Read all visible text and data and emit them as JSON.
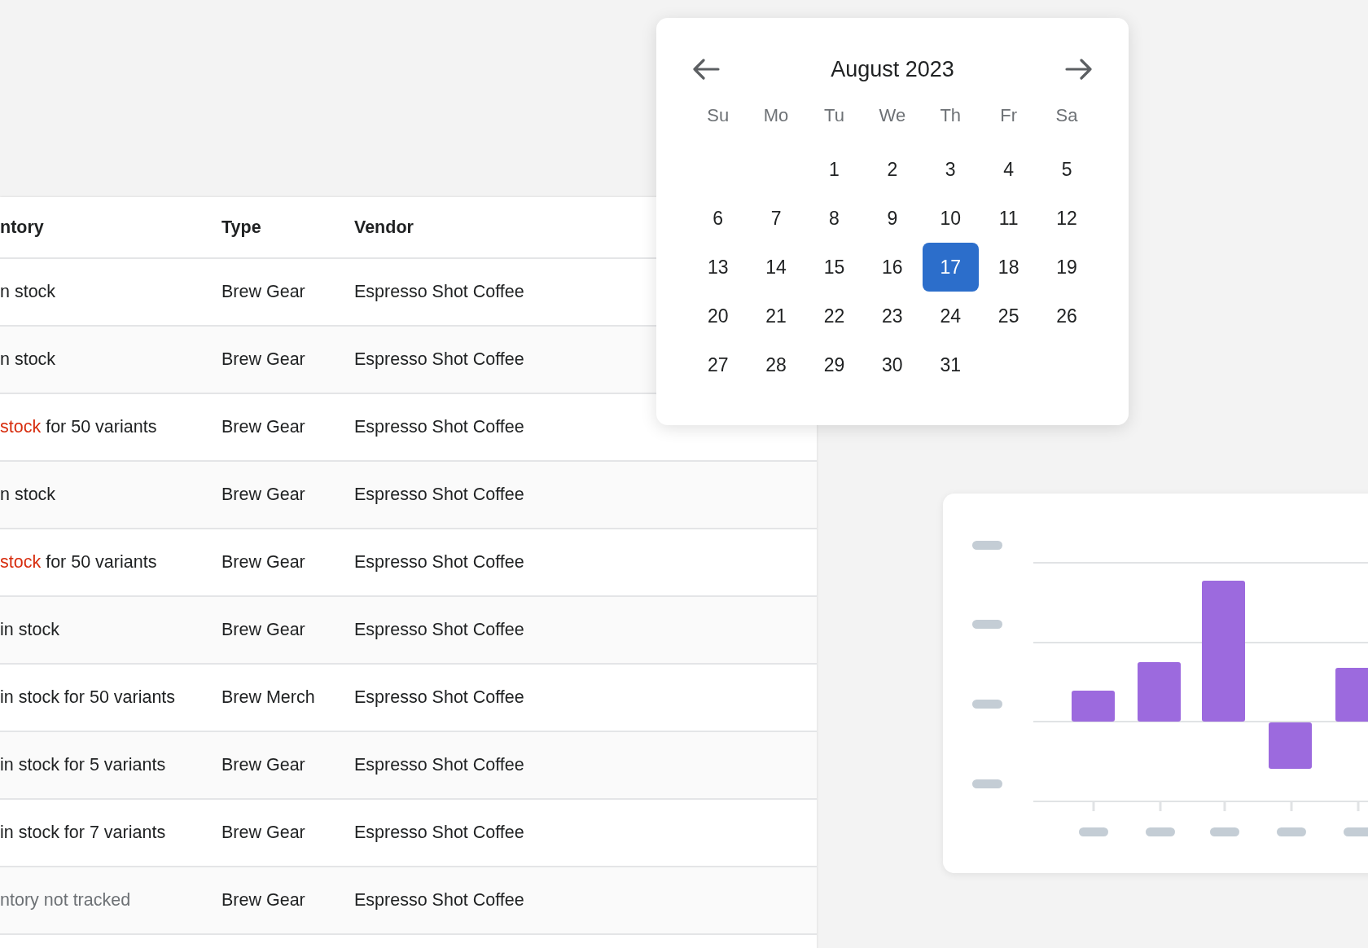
{
  "table": {
    "columns": [
      "ntory",
      "Type",
      "Vendor"
    ],
    "rows": [
      {
        "inventory": [
          {
            "text": "n stock",
            "kind": "default"
          }
        ],
        "type": "Brew Gear",
        "vendor": "Espresso Shot Coffee"
      },
      {
        "inventory": [
          {
            "text": "n stock",
            "kind": "default"
          }
        ],
        "type": "Brew Gear",
        "vendor": "Espresso Shot Coffee"
      },
      {
        "inventory": [
          {
            "text": "stock",
            "kind": "critical"
          },
          {
            "text": " for 50 variants",
            "kind": "default"
          }
        ],
        "type": "Brew Gear",
        "vendor": "Espresso Shot Coffee"
      },
      {
        "inventory": [
          {
            "text": "n stock",
            "kind": "default"
          }
        ],
        "type": "Brew Gear",
        "vendor": "Espresso Shot Coffee"
      },
      {
        "inventory": [
          {
            "text": "stock",
            "kind": "critical"
          },
          {
            "text": " for 50 variants",
            "kind": "default"
          }
        ],
        "type": "Brew Gear",
        "vendor": "Espresso Shot Coffee"
      },
      {
        "inventory": [
          {
            "text": " in stock",
            "kind": "default"
          }
        ],
        "type": "Brew Gear",
        "vendor": "Espresso Shot Coffee"
      },
      {
        "inventory": [
          {
            "text": " in stock for 50 variants",
            "kind": "default"
          }
        ],
        "type": "Brew Merch",
        "vendor": "Espresso Shot Coffee"
      },
      {
        "inventory": [
          {
            "text": " in stock for 5 variants",
            "kind": "default"
          }
        ],
        "type": "Brew Gear",
        "vendor": "Espresso Shot Coffee"
      },
      {
        "inventory": [
          {
            "text": " in stock for 7 variants",
            "kind": "default"
          }
        ],
        "type": "Brew Gear",
        "vendor": "Espresso Shot Coffee"
      },
      {
        "inventory": [
          {
            "text": "ntory not tracked",
            "kind": "subdued"
          }
        ],
        "type": "Brew Gear",
        "vendor": "Espresso Shot Coffee"
      }
    ]
  },
  "calendar": {
    "title": "August 2023",
    "weekdays": [
      "Su",
      "Mo",
      "Tu",
      "We",
      "Th",
      "Fr",
      "Sa"
    ],
    "weeks": [
      {
        "kind": "first",
        "days": [
          {
            "day": "1",
            "selected": false
          },
          {
            "day": "2",
            "selected": false
          },
          {
            "day": "3",
            "selected": false
          },
          {
            "day": "4",
            "selected": false
          },
          {
            "day": "5",
            "selected": false
          }
        ]
      },
      {
        "kind": "full",
        "days": [
          {
            "day": "6",
            "selected": false
          },
          {
            "day": "7",
            "selected": false
          },
          {
            "day": "8",
            "selected": false
          },
          {
            "day": "9",
            "selected": false
          },
          {
            "day": "10",
            "selected": false
          },
          {
            "day": "11",
            "selected": false
          },
          {
            "day": "12",
            "selected": false
          }
        ]
      },
      {
        "kind": "full",
        "days": [
          {
            "day": "13",
            "selected": false
          },
          {
            "day": "14",
            "selected": false
          },
          {
            "day": "15",
            "selected": false
          },
          {
            "day": "16",
            "selected": false
          },
          {
            "day": "17",
            "selected": true
          },
          {
            "day": "18",
            "selected": false
          },
          {
            "day": "19",
            "selected": false
          }
        ]
      },
      {
        "kind": "full",
        "days": [
          {
            "day": "20",
            "selected": false
          },
          {
            "day": "21",
            "selected": false
          },
          {
            "day": "22",
            "selected": false
          },
          {
            "day": "23",
            "selected": false
          },
          {
            "day": "24",
            "selected": false
          },
          {
            "day": "25",
            "selected": false
          },
          {
            "day": "26",
            "selected": false
          }
        ]
      },
      {
        "kind": "last",
        "days": [
          {
            "day": "27",
            "selected": false
          },
          {
            "day": "28",
            "selected": false
          },
          {
            "day": "29",
            "selected": false
          },
          {
            "day": "30",
            "selected": false
          },
          {
            "day": "31",
            "selected": false
          }
        ]
      }
    ]
  }
}
